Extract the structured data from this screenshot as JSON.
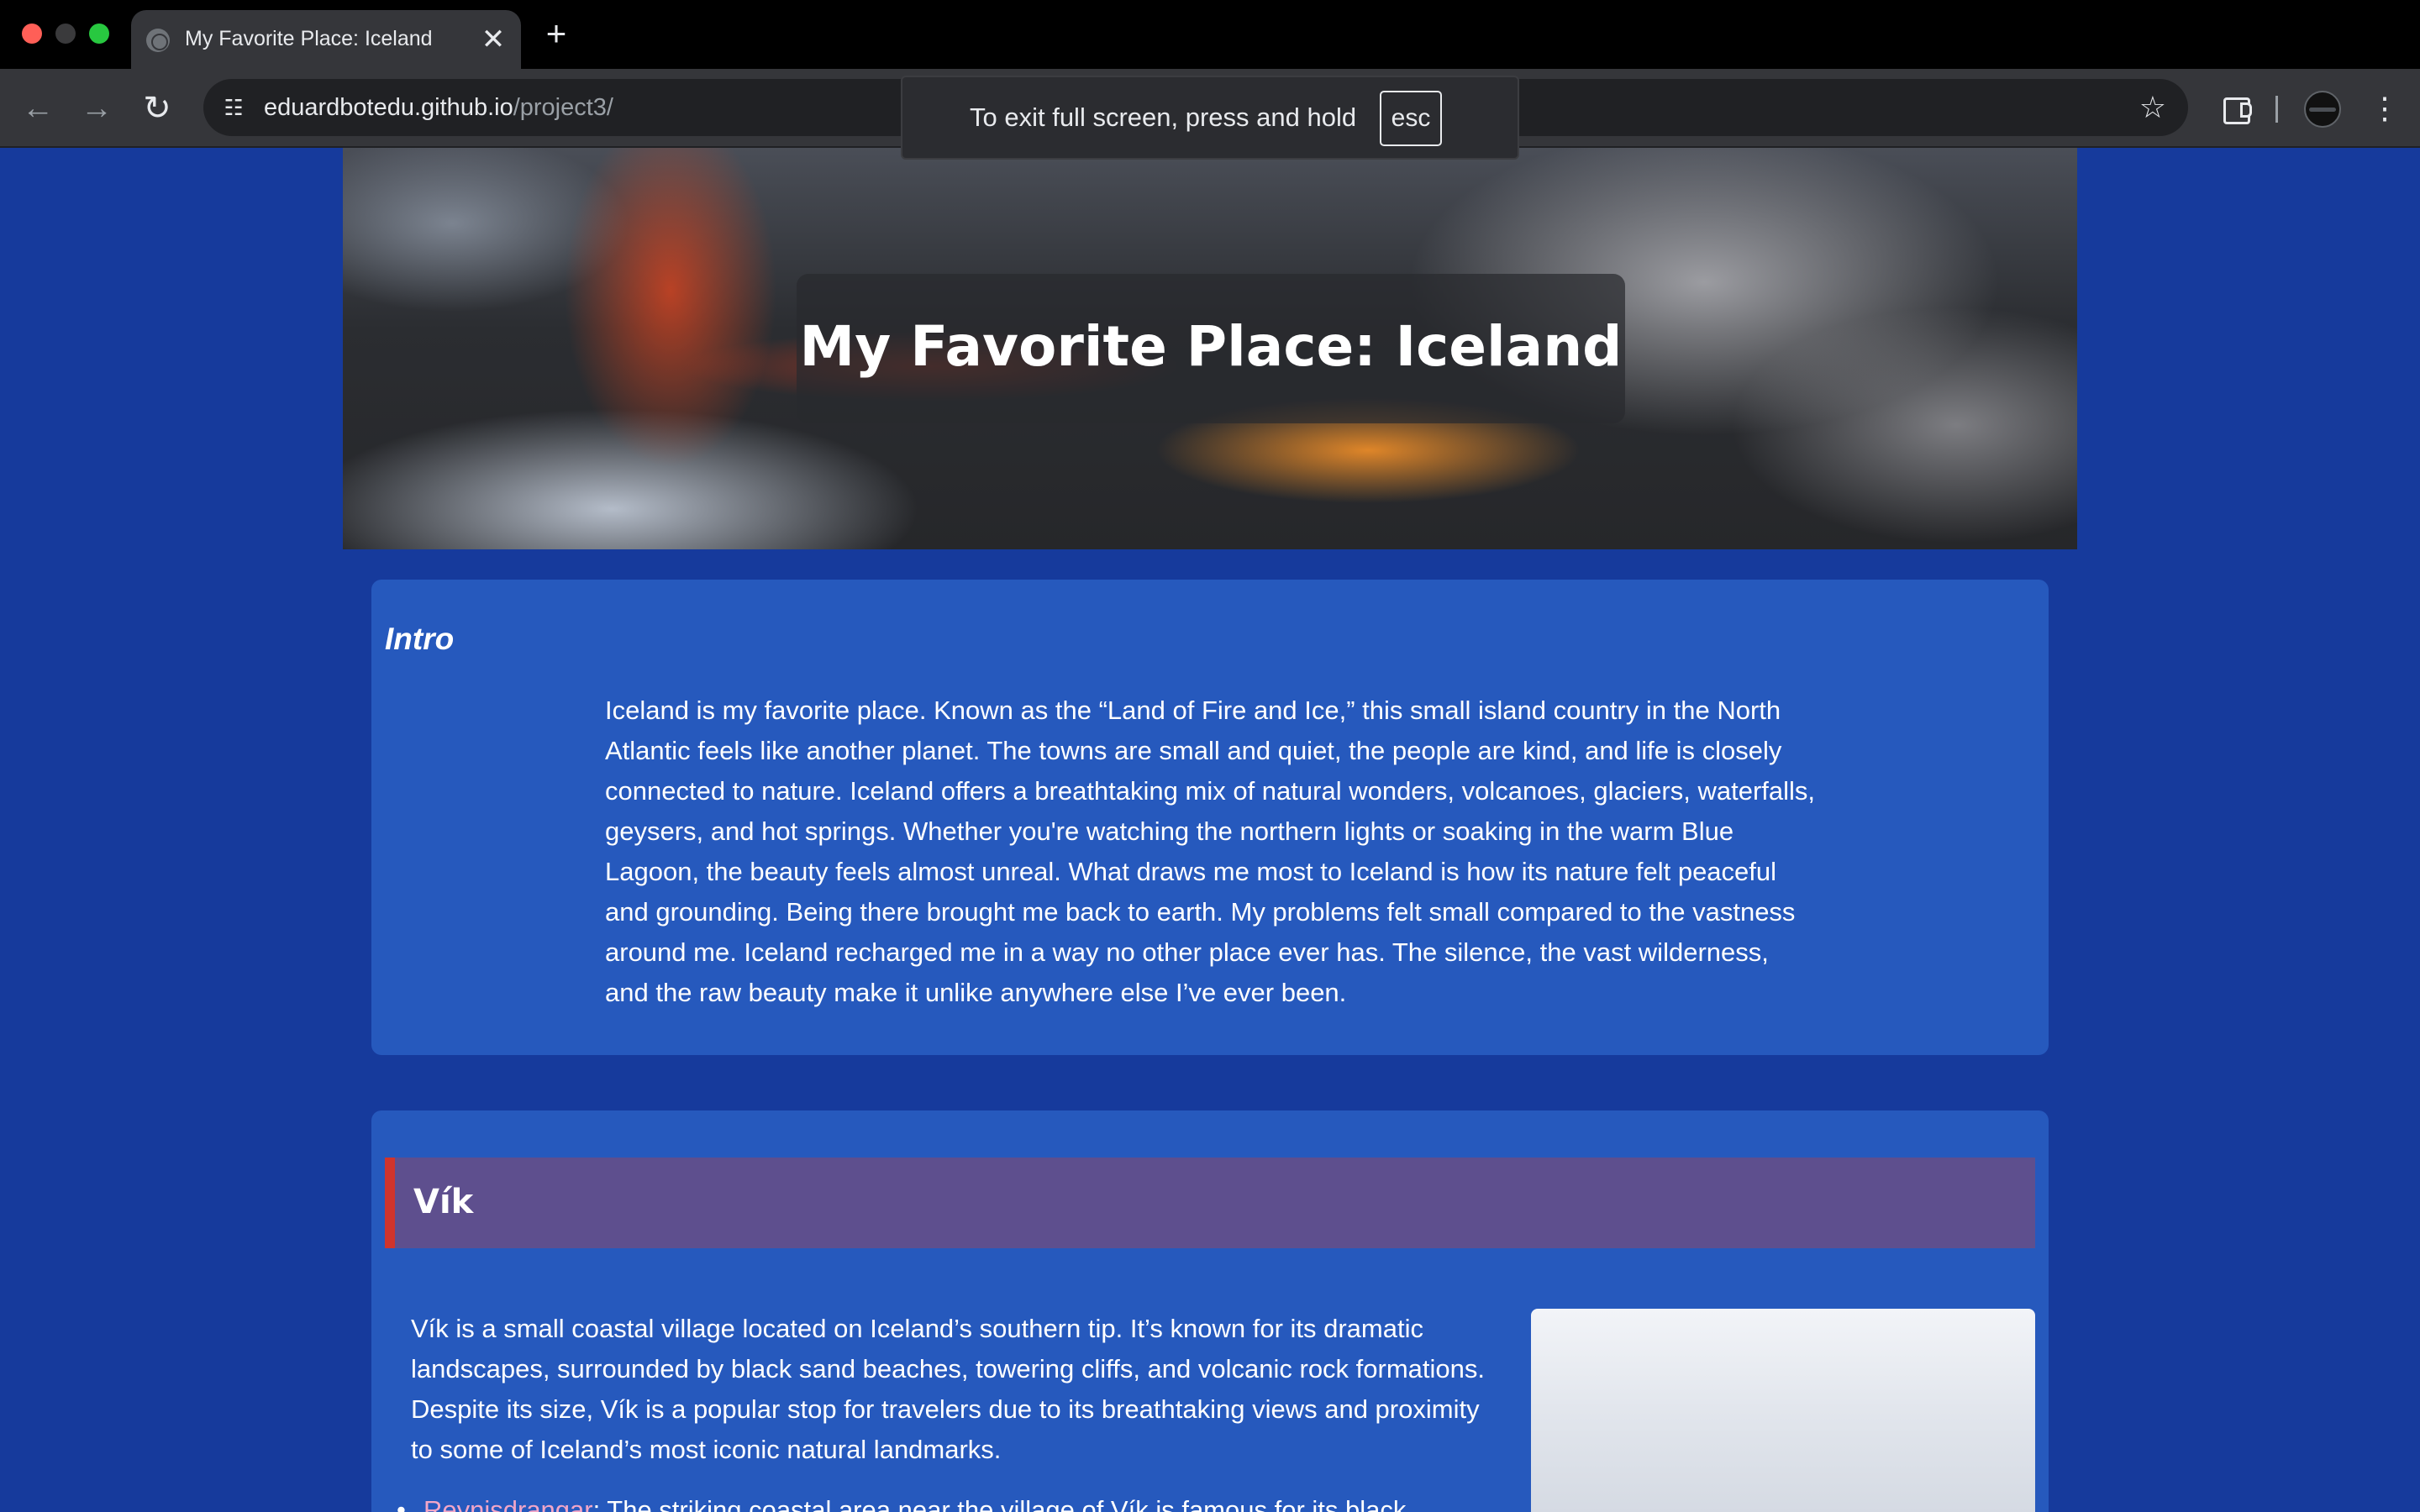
{
  "browser": {
    "tab_title": "My Favorite Place: Iceland",
    "tab_close": "✕",
    "new_tab": "+",
    "url_host": "eduardbotedu.github.io",
    "url_path": "/project3/",
    "fullscreen_notice": "To exit full screen, press and hold",
    "fullscreen_key": "esc"
  },
  "hero": {
    "title": "My Favorite Place: Iceland"
  },
  "intro": {
    "heading": "Intro",
    "text": "Iceland is my favorite place. Known as the “Land of Fire and Ice,” this small island country in the North Atlantic feels like another planet. The towns are small and quiet, the people are kind, and life is closely connected to nature. Iceland offers a breathtaking mix of natural wonders, volcanoes, glaciers, waterfalls, geysers, and hot springs. Whether you're watching the northern lights or soaking in the warm Blue Lagoon, the beauty feels almost unreal. What draws me most to Iceland is how its nature felt peaceful and grounding. Being there brought me back to earth. My problems felt small compared to the vastness around me. Iceland recharged me in a way no other place ever has. The silence, the vast wilderness, and the raw beauty make it unlike anywhere else I’ve ever been."
  },
  "vik": {
    "heading": "Vík",
    "text": "Vík is a small coastal village located on Iceland’s southern tip. It’s known for its dramatic landscapes, surrounded by black sand beaches, towering cliffs, and volcanic rock formations. Despite its size, Vík is a popular stop for travelers due to its breathtaking views and proximity to some of Iceland’s most iconic natural landmarks.",
    "list": [
      {
        "link": "Reynisdrangar",
        "text": ": The striking coastal area near the village of Vík is famous for its black"
      }
    ]
  },
  "colors": {
    "page_bg": "#163a9c",
    "card_bg": "#2659bd",
    "vik_banner_bg": "#5e4f8e",
    "vik_banner_accent": "#d0342c",
    "link": "#f2a6c8"
  },
  "icons": [
    "globe-icon",
    "close-icon",
    "plus-icon",
    "back-arrow-icon",
    "forward-arrow-icon",
    "reload-icon",
    "site-info-icon",
    "star-icon",
    "extensions-icon",
    "profile-avatar-icon",
    "kebab-menu-icon"
  ]
}
